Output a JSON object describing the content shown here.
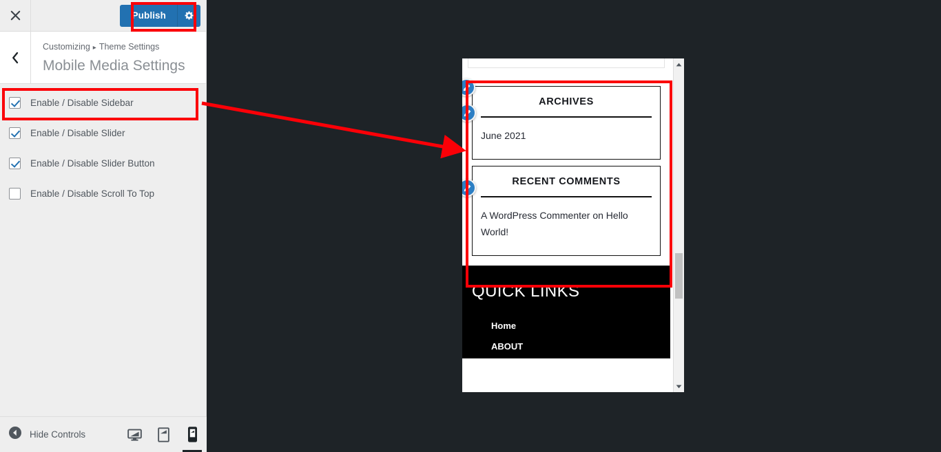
{
  "app": {
    "name": "WordPress Customizer",
    "accent_blue": "#2271b1",
    "annotation_red": "#fb0007",
    "panel_bg": "#eeeeee",
    "preview_bg": "#1e2327"
  },
  "header": {
    "close_icon": "close-icon",
    "close_title": "Close the Customizer",
    "publish_label": "Publish",
    "publish_gear_icon": "gear-icon"
  },
  "section": {
    "back_icon": "chevron-left-icon",
    "breadcrumb": {
      "root": "Customizing",
      "separator": "▸",
      "parent": "Theme Settings"
    },
    "title": "Mobile Media Settings"
  },
  "controls": [
    {
      "label": "Enable / Disable Sidebar",
      "checked": true,
      "name": "checkbox-enable-disable-sidebar"
    },
    {
      "label": "Enable / Disable Slider",
      "checked": true,
      "name": "checkbox-enable-disable-slider"
    },
    {
      "label": "Enable / Disable Slider Button",
      "checked": true,
      "name": "checkbox-enable-disable-slider-button"
    },
    {
      "label": "Enable / Disable Scroll To Top",
      "checked": false,
      "name": "checkbox-enable-disable-scroll-to-top"
    }
  ],
  "footer": {
    "hide_controls_label": "Hide Controls",
    "collapse_icon": "collapse-arrow-icon",
    "devices": [
      {
        "label": "Desktop",
        "icon": "desktop-icon",
        "active": false
      },
      {
        "label": "Tablet",
        "icon": "tablet-icon",
        "active": false
      },
      {
        "label": "Mobile",
        "icon": "mobile-icon",
        "active": true
      }
    ]
  },
  "preview": {
    "device": "mobile",
    "widgets": [
      {
        "title": "ARCHIVES",
        "items": [
          "June 2021"
        ]
      },
      {
        "title": "RECENT COMMENTS",
        "items": [
          "A WordPress Commenter on Hello World!"
        ]
      }
    ],
    "site_footer": {
      "title": "QUICK LINKS",
      "links": [
        "Home",
        "ABOUT"
      ]
    },
    "edit_shortcut_icon": "pencil-edit-icon",
    "scrollbar": {
      "up_icon": "scroll-up-arrow-icon",
      "down_icon": "scroll-down-arrow-icon",
      "thumb_position_percent": 62
    }
  },
  "annotations": [
    {
      "name": "annotation-box-publish",
      "target": "Publish button"
    },
    {
      "name": "annotation-box-checkbox",
      "target": "Enable / Disable Sidebar checkbox"
    },
    {
      "name": "annotation-box-widgets",
      "target": "Sidebar widgets in preview"
    },
    {
      "name": "annotation-arrow",
      "target": "From sidebar checkbox to preview widgets"
    }
  ]
}
